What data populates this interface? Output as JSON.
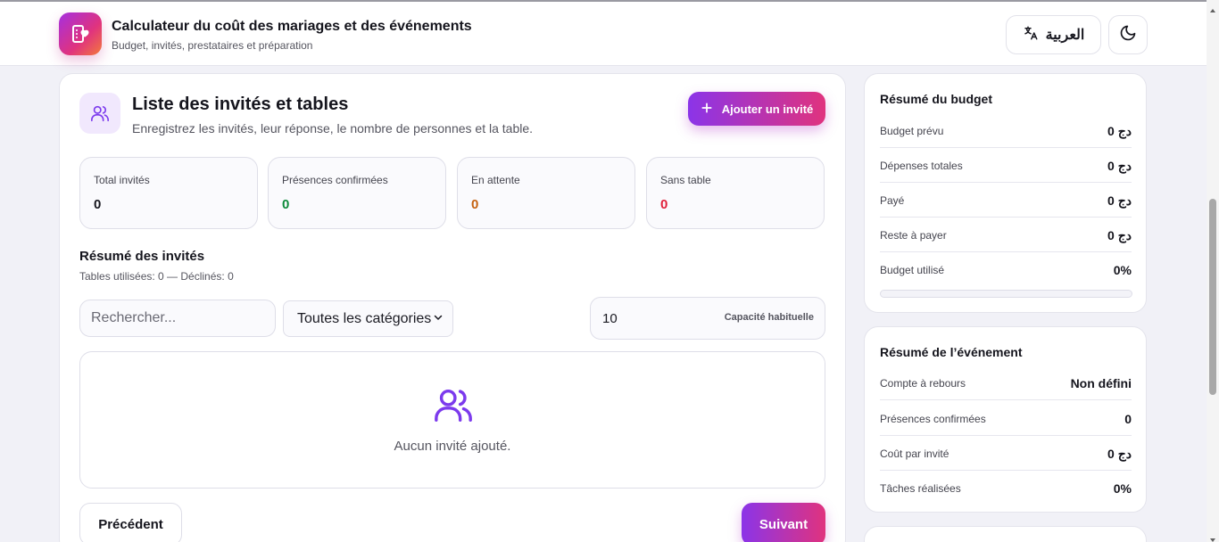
{
  "header": {
    "title": "Calculateur du coût des mariages et des événements",
    "subtitle": "Budget, invités, prestataires et préparation",
    "language_label": "العربية"
  },
  "guests": {
    "title": "Liste des invités et tables",
    "description": "Enregistrez les invités, leur réponse, le nombre de personnes et la table.",
    "add_label": "Ajouter un invité",
    "stats": [
      {
        "label": "Total invités",
        "value": "0",
        "color": "#15151d"
      },
      {
        "label": "Présences confirmées",
        "value": "0",
        "color": "#0d8a3a"
      },
      {
        "label": "En attente",
        "value": "0",
        "color": "#c5610f"
      },
      {
        "label": "Sans table",
        "value": "0",
        "color": "#e0203a"
      }
    ],
    "summary_title": "Résumé des invités",
    "summary_sub": "Tables utilisées: 0 — Déclinés: 0",
    "search_placeholder": "Rechercher...",
    "category_selected": "Toutes les catégories",
    "capacity_value": "10",
    "capacity_label": "Capacité habituelle",
    "empty_text": "Aucun invité ajouté.",
    "prev_label": "Précédent",
    "next_label": "Suivant"
  },
  "budget": {
    "title": "Résumé du budget",
    "rows": [
      {
        "label": "Budget prévu",
        "value": "دج 0"
      },
      {
        "label": "Dépenses totales",
        "value": "دج 0"
      },
      {
        "label": "Payé",
        "value": "دج 0"
      },
      {
        "label": "Reste à payer",
        "value": "دج 0"
      },
      {
        "label": "Budget utilisé",
        "value": "0%"
      }
    ],
    "used_fraction": 0
  },
  "event": {
    "title": "Résumé de l’événement",
    "rows": [
      {
        "label": "Compte à rebours",
        "value": "Non défini"
      },
      {
        "label": "Présences confirmées",
        "value": "0"
      },
      {
        "label": "Coût par invité",
        "value": "دج 0"
      },
      {
        "label": "Tâches réalisées",
        "value": "0%"
      }
    ]
  },
  "colors": {
    "accent_start": "#8b34e8",
    "accent_end": "#e0337e",
    "icon_purple": "#7c3aed"
  },
  "icons": [
    "app-logo-icon",
    "translate-icon",
    "moon-icon",
    "users-icon",
    "plus-icon",
    "chevron-down-icon"
  ]
}
